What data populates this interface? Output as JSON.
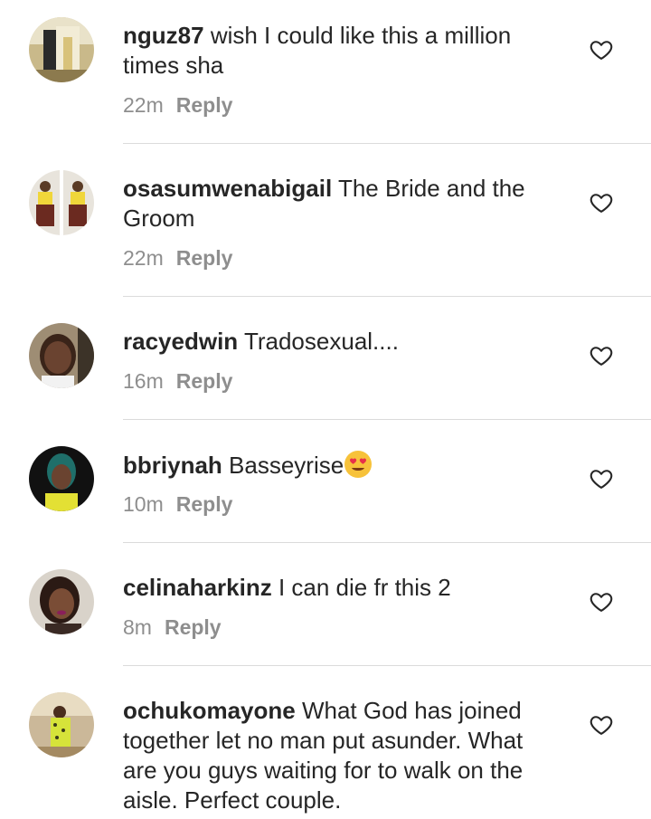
{
  "comments": [
    {
      "username": "nguz87",
      "text": "wish I could like this a million times sha",
      "time": "22m",
      "reply_label": "Reply",
      "avatar_icon": "user-avatar-photo"
    },
    {
      "username": "osasumwenabigail",
      "text": "The Bride and the Groom",
      "time": "22m",
      "reply_label": "Reply",
      "avatar_icon": "user-avatar-photo"
    },
    {
      "username": "racyedwin",
      "text": "Tradosexual....",
      "time": "16m",
      "reply_label": "Reply",
      "avatar_icon": "user-avatar-photo"
    },
    {
      "username": "bbriynah",
      "text": "Basseyrise",
      "emoji": "heart-eyes-emoji",
      "time": "10m",
      "reply_label": "Reply",
      "avatar_icon": "user-avatar-photo"
    },
    {
      "username": "celinaharkinz",
      "text": "I can die fr this 2",
      "time": "8m",
      "reply_label": "Reply",
      "avatar_icon": "user-avatar-photo"
    },
    {
      "username": "ochukomayone",
      "text": "What God has joined together let no man put asunder. What are you guys waiting for to walk on the aisle. Perfect couple.",
      "time": "",
      "reply_label": "",
      "avatar_icon": "user-avatar-photo"
    }
  ],
  "icons": {
    "like": "heart-outline-icon"
  },
  "colors": {
    "text": "#262626",
    "secondary": "#8e8e8e",
    "divider": "#dbdbdb"
  }
}
